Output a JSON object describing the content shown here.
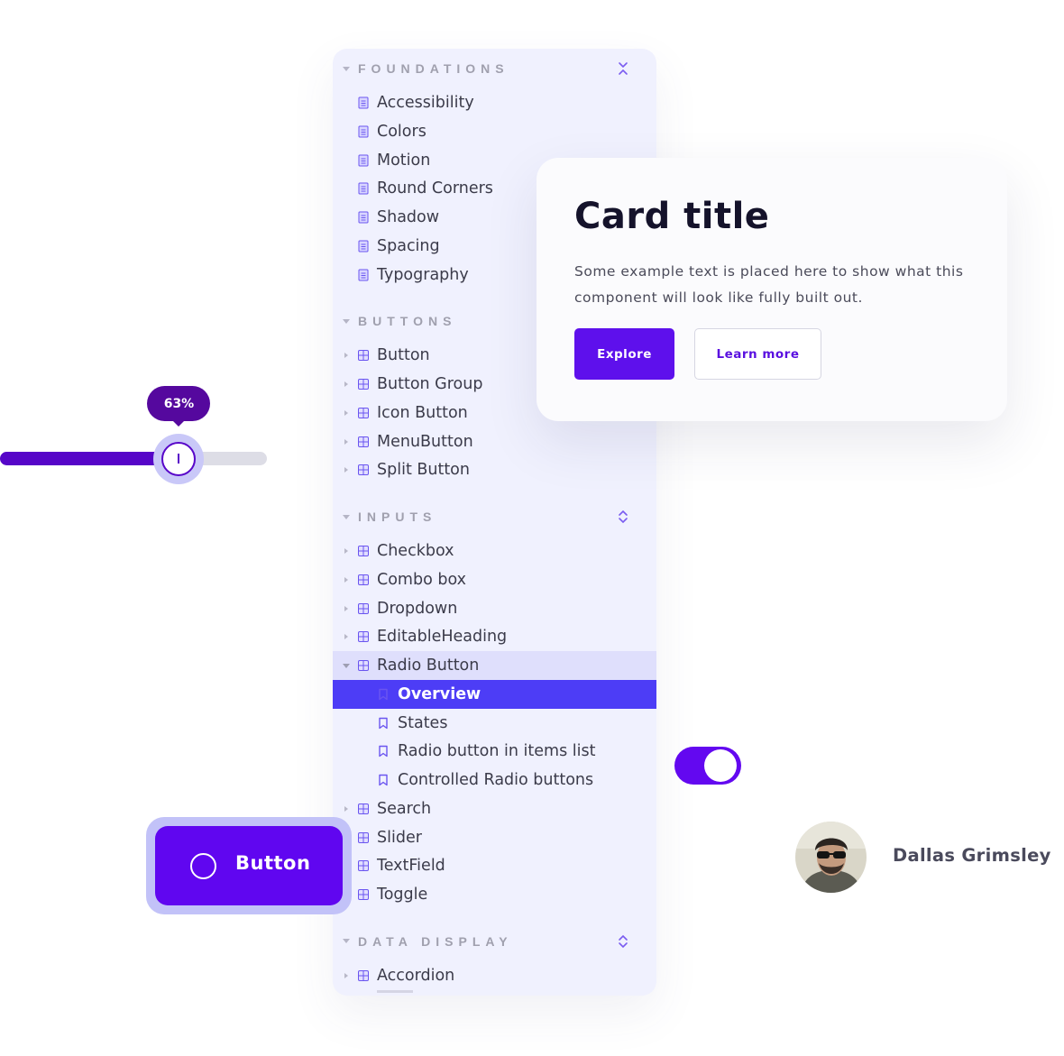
{
  "sidebar": {
    "sections": [
      {
        "title": "FOUNDATIONS",
        "control_icon": "collapse-all-icon",
        "items": [
          {
            "label": "Accessibility",
            "icon": "document-icon"
          },
          {
            "label": "Colors",
            "icon": "document-icon"
          },
          {
            "label": "Motion",
            "icon": "document-icon"
          },
          {
            "label": "Round Corners",
            "icon": "document-icon"
          },
          {
            "label": "Shadow",
            "icon": "document-icon"
          },
          {
            "label": "Spacing",
            "icon": "document-icon"
          },
          {
            "label": "Typography",
            "icon": "document-icon"
          }
        ]
      },
      {
        "title": "BUTTONS",
        "items": [
          {
            "label": "Button",
            "icon": "component-icon"
          },
          {
            "label": "Button Group",
            "icon": "component-icon"
          },
          {
            "label": "Icon Button",
            "icon": "component-icon"
          },
          {
            "label": "MenuButton",
            "icon": "component-icon"
          },
          {
            "label": "Split Button",
            "icon": "component-icon"
          }
        ]
      },
      {
        "title": "INPUTS",
        "control_icon": "expand-all-icon",
        "items": [
          {
            "label": "Checkbox",
            "icon": "component-icon"
          },
          {
            "label": "Combo box",
            "icon": "component-icon"
          },
          {
            "label": "Dropdown",
            "icon": "component-icon"
          },
          {
            "label": "EditableHeading",
            "icon": "component-icon"
          },
          {
            "label": "Radio Button",
            "icon": "component-icon",
            "expanded": true,
            "children": [
              {
                "label": "Overview",
                "icon": "bookmark-icon",
                "active": true
              },
              {
                "label": "States",
                "icon": "bookmark-icon"
              },
              {
                "label": "Radio button in items list",
                "icon": "bookmark-icon"
              },
              {
                "label": "Controlled Radio buttons",
                "icon": "bookmark-icon"
              }
            ]
          },
          {
            "label": "Search",
            "icon": "component-icon"
          },
          {
            "label": "Slider",
            "icon": "component-icon"
          },
          {
            "label": "TextField",
            "icon": "component-icon"
          },
          {
            "label": "Toggle",
            "icon": "component-icon"
          }
        ]
      },
      {
        "title": "DATA DISPLAY",
        "control_icon": "expand-all-icon",
        "items": [
          {
            "label": "Accordion",
            "icon": "component-icon"
          }
        ]
      }
    ]
  },
  "card": {
    "title": "Card title",
    "text": "Some example text is placed here to show what this component will look like fully built out.",
    "primary_button": "Explore",
    "secondary_button": "Learn more"
  },
  "slider": {
    "value_label": "63%",
    "value": 0.63
  },
  "big_button": {
    "label": "Button",
    "icon": "circle-icon"
  },
  "toggle": {
    "on": true
  },
  "user": {
    "name": "Dallas Grimsley",
    "avatar_icon": "avatar-photo"
  },
  "colors": {
    "accent": "#6006f0",
    "sidebar_bg": "#f0f1fe",
    "active_item": "#4d3df6",
    "slider_fill": "#5606c8"
  }
}
